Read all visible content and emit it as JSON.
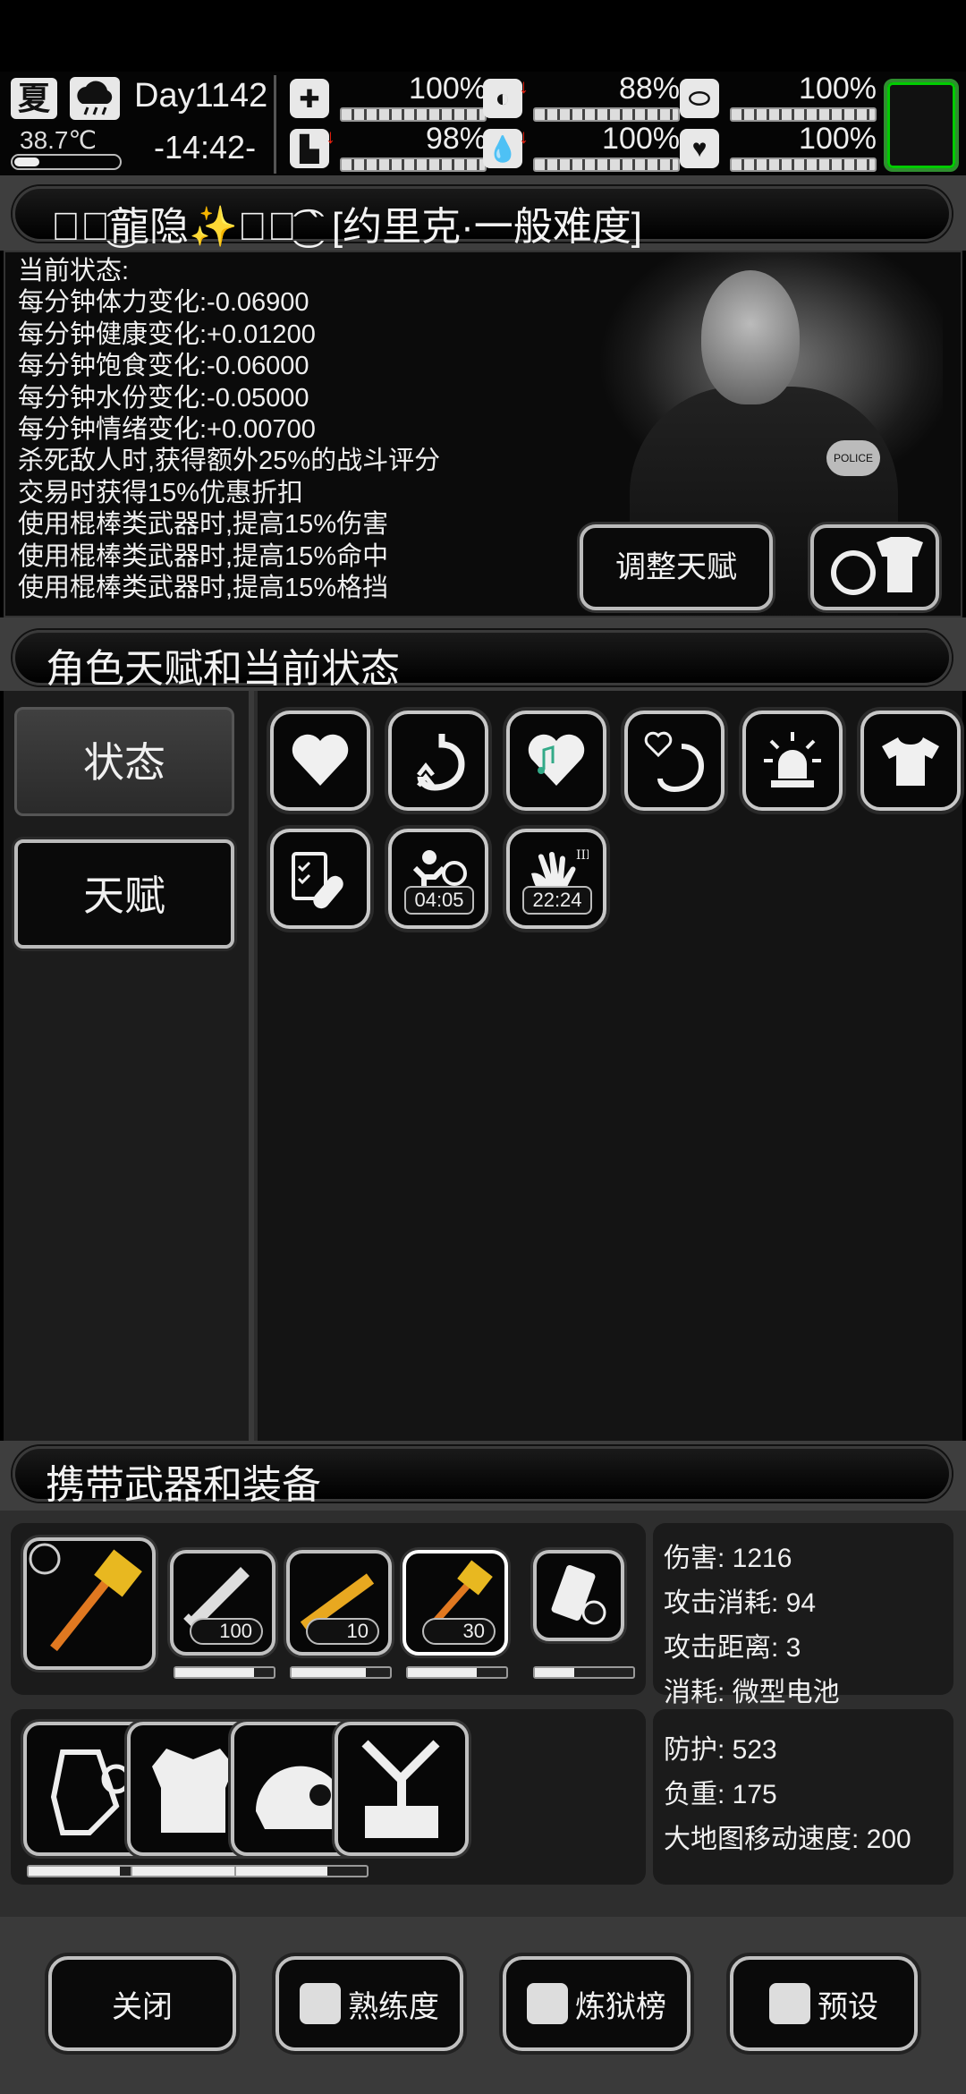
{
  "top": {
    "season": "夏",
    "temperature": "38.7℃",
    "day": "Day1142",
    "time": "-14:42-",
    "stats": [
      {
        "name": "medkit",
        "value": "100%",
        "down": false
      },
      {
        "name": "stomach",
        "value": "88%",
        "down": true
      },
      {
        "name": "bladder",
        "value": "100%",
        "down": false
      },
      {
        "name": "foot",
        "value": "98%",
        "down": true
      },
      {
        "name": "water",
        "value": "100%",
        "down": true
      },
      {
        "name": "heart",
        "value": "100%",
        "down": false
      }
    ]
  },
  "character": {
    "name_banner": "ঔৣ͜͡龍隐✨ঔৣ͜͡ ˋ [约里克·一般难度]",
    "status_lines": [
      "当前状态:",
      "每分钟体力变化:-0.06900",
      "每分钟健康变化:+0.01200",
      "每分钟饱食变化:-0.06000",
      "每分钟水份变化:-0.05000",
      "每分钟情绪变化:+0.00700",
      "杀死敌人时,获得额外25%的战斗评分",
      "交易时获得15%优惠折扣",
      "使用棍棒类武器时,提高15%伤害",
      "使用棍棒类武器时,提高15%命中",
      "使用棍棒类武器时,提高15%格挡"
    ],
    "adjust_talent_btn": "调整天赋",
    "patch_text": "POLICE"
  },
  "talent_section": {
    "title": "角色天赋和当前状态",
    "tabs": [
      "状态",
      "天赋"
    ],
    "icons": [
      {
        "name": "heart-icon"
      },
      {
        "name": "stomach-up-icon"
      },
      {
        "name": "music-heart-icon"
      },
      {
        "name": "heart-stomach-icon"
      },
      {
        "name": "alarm-light-icon"
      },
      {
        "name": "shirt-icon"
      },
      {
        "name": "clipboard-pill-icon"
      },
      {
        "name": "sleep-person-icon",
        "timer": "04:05"
      },
      {
        "name": "hand-icon",
        "timer": "22:24"
      }
    ]
  },
  "equipment": {
    "title": "携带武器和装备",
    "weapon_stats": [
      "伤害: 1216",
      "攻击消耗: 94",
      "攻击距离: 3",
      "消耗: 微型电池"
    ],
    "weapon_counts": [
      "100",
      "10",
      "30"
    ],
    "armor_stats": [
      "防护: 523",
      "负重: 175",
      "大地图移动速度: 200"
    ],
    "weapon_durability": [
      0.8,
      0.75,
      0.7,
      0.4
    ],
    "armor_durability": [
      0.7,
      0.8,
      0.7
    ]
  },
  "bottom": {
    "close": "关闭",
    "proficiency": "熟练度",
    "ranking": "炼狱榜",
    "preset": "预设"
  }
}
